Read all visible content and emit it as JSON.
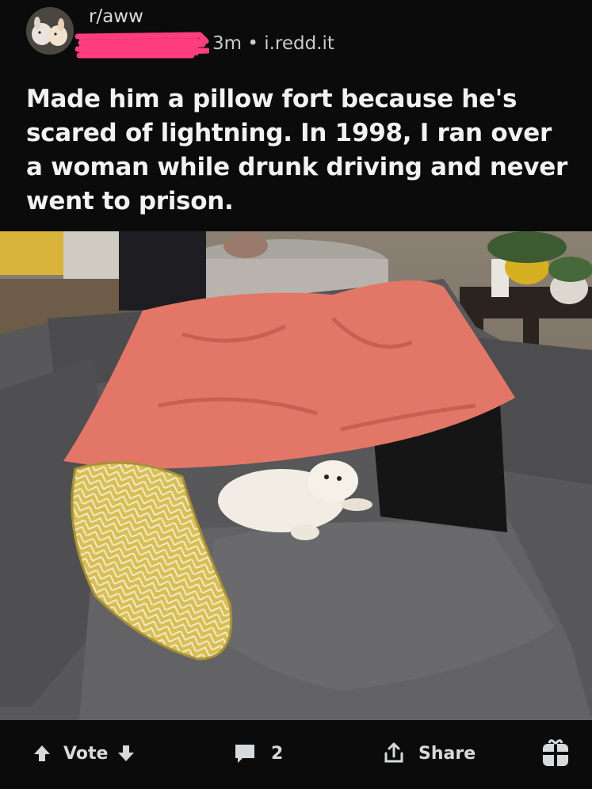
{
  "post": {
    "subreddit": "r/aww",
    "meta": "3m • i.redd.it",
    "title": "Made him a pillow fort because he's scared of lightning. In 1998, I ran over a woman while drunk driving and never went to prison."
  },
  "actions": {
    "vote_label": "Vote",
    "comment_count": "2",
    "share_label": "Share"
  },
  "colors": {
    "background": "#0b0b0c",
    "redaction": "#ff3d7f",
    "blanket": "#e37767",
    "pillow": "#d9c053",
    "couch": "#5e5d5f"
  },
  "icons": [
    "upvote-arrow-icon",
    "downvote-arrow-icon",
    "comment-icon",
    "share-icon",
    "award-gift-icon"
  ]
}
